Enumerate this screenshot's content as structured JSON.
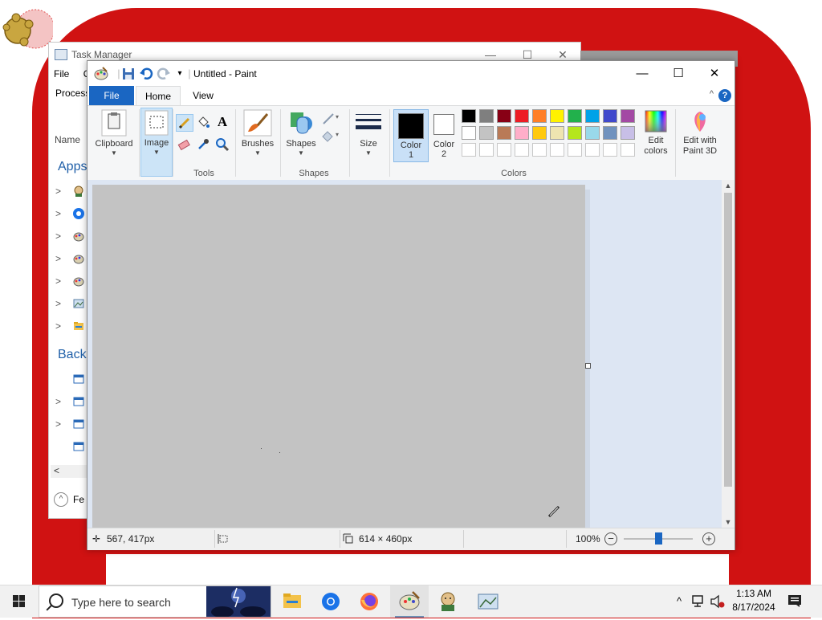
{
  "task_manager": {
    "title": "Task Manager",
    "menu": [
      "File",
      "O"
    ],
    "tab": "Process",
    "column_name": "Name",
    "section_apps": "Apps",
    "section_background": "Backg",
    "fewer_details": "Fe",
    "controls": {
      "minimize": "—",
      "maximize": "☐",
      "close": "✕"
    },
    "scroll_left": "<"
  },
  "paint": {
    "title": "Untitled - Paint",
    "controls": {
      "minimize": "—",
      "maximize": "☐",
      "close": "✕"
    },
    "tabs": {
      "file": "File",
      "home": "Home",
      "view": "View"
    },
    "help": "?",
    "collapse": "^",
    "groups": {
      "clipboard": "Clipboard",
      "image": "Image",
      "tools": "Tools",
      "brushes": "Brushes",
      "shapes_btn": "Shapes",
      "shapes_group": "Shapes",
      "size": "Size",
      "colors": "Colors"
    },
    "color1_label": "Color",
    "color1_num": "1",
    "color2_label": "Color",
    "color2_num": "2",
    "edit_colors_line1": "Edit",
    "edit_colors_line2": "colors",
    "paint3d_line1": "Edit with",
    "paint3d_line2": "Paint 3D",
    "palette_row1": [
      "#000000",
      "#7f7f7f",
      "#880015",
      "#ed1c24",
      "#ff7f27",
      "#fff200",
      "#22b14c",
      "#00a2e8",
      "#3f48cc",
      "#a349a4"
    ],
    "palette_row2": [
      "#ffffff",
      "#c3c3c3",
      "#b97a57",
      "#ffaec9",
      "#ffc90e",
      "#efe4b0",
      "#b5e61d",
      "#99d9ea",
      "#7092be",
      "#c8bfe7"
    ],
    "status": {
      "cursor_pos": "567, 417px",
      "canvas_size": "614 × 460px",
      "zoom": "100%",
      "zoom_level": 1.0
    }
  },
  "taskbar": {
    "search_placeholder": "Type here to search",
    "time": "1:13 AM",
    "date": "8/17/2024"
  },
  "colors": {
    "wallpaper_red": "#d01212",
    "accent_blue": "#1a66c2",
    "canvas_gray": "#c3c3c3",
    "workspace": "#dde6f3"
  }
}
